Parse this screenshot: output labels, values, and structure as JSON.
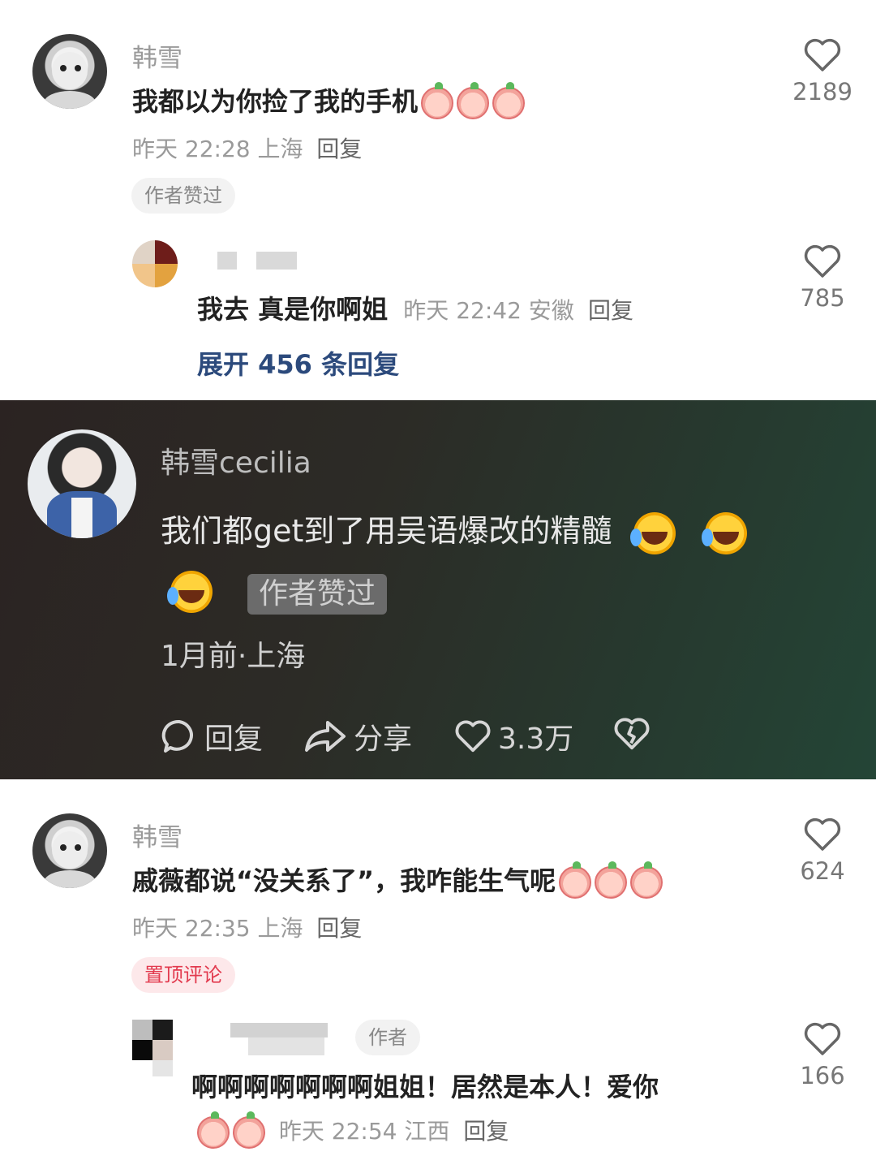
{
  "comments": [
    {
      "username": "韩雪",
      "text": "我都以为你捡了我的手机",
      "time": "昨天 22:28 上海",
      "reply": "回复",
      "tag": "作者赞过",
      "likes": "2189",
      "emoji_count": 3
    },
    {
      "username": "韩雪",
      "text": "戚薇都说“没关系了”，我咋能生气呢",
      "time": "昨天 22:35 上海",
      "reply": "回复",
      "tag": "置顶评论",
      "likes": "624",
      "emoji_count": 3
    }
  ],
  "replies": [
    {
      "text": "我去 真是你啊姐",
      "time": "昨天 22:42 安徽",
      "reply": "回复",
      "likes": "785"
    },
    {
      "author_tag": "作者",
      "text": "啊啊啊啊啊啊啊姐姐！居然是本人！爱你",
      "time": "昨天 22:54 江西",
      "reply": "回复",
      "likes": "166"
    }
  ],
  "expand_label": "展开 456 条回复",
  "screenshot_comment": {
    "username": "韩雪cecilia",
    "text": "我们都get到了用吴语爆改的精髓",
    "tag": "作者赞过",
    "meta": "1月前·上海",
    "actions": {
      "reply": "回复",
      "share": "分享",
      "likes": "3.3万"
    }
  },
  "colors": {
    "accent_link": "#2c4a7c",
    "pinned_tag": "#e23a4e"
  }
}
